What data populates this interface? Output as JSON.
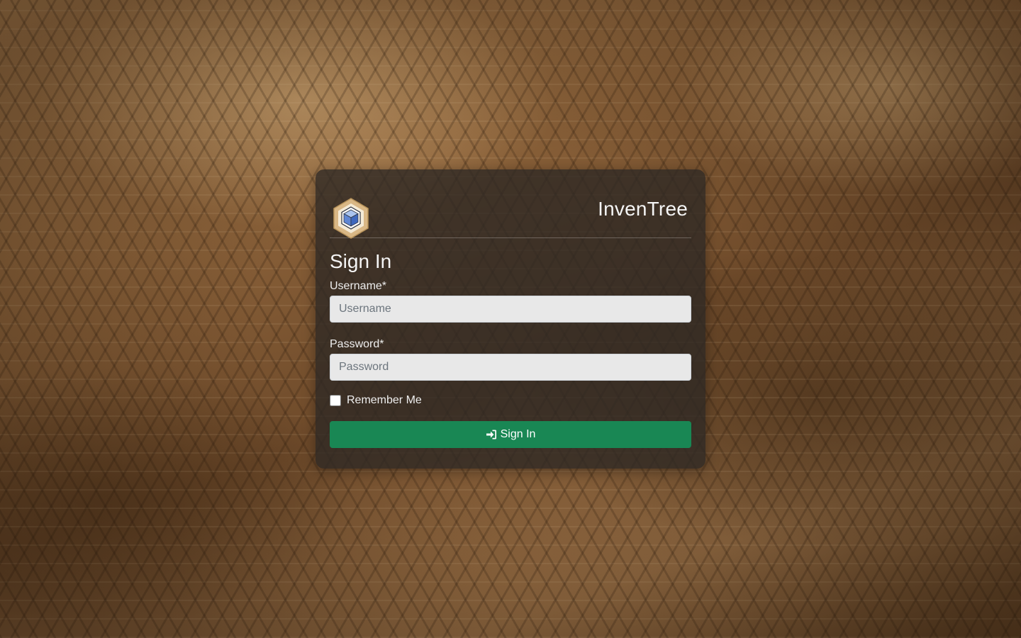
{
  "app": {
    "title": "InvenTree",
    "logo_icon": "inventree-logo-icon"
  },
  "form": {
    "heading": "Sign In",
    "username": {
      "label": "Username*",
      "placeholder": "Username",
      "value": ""
    },
    "password": {
      "label": "Password*",
      "placeholder": "Password",
      "value": ""
    },
    "remember": {
      "label": "Remember Me",
      "checked": false
    },
    "submit": {
      "label": "Sign In",
      "icon": "sign-in-icon"
    }
  },
  "colors": {
    "button": "#198754",
    "card": "#2d2824"
  }
}
